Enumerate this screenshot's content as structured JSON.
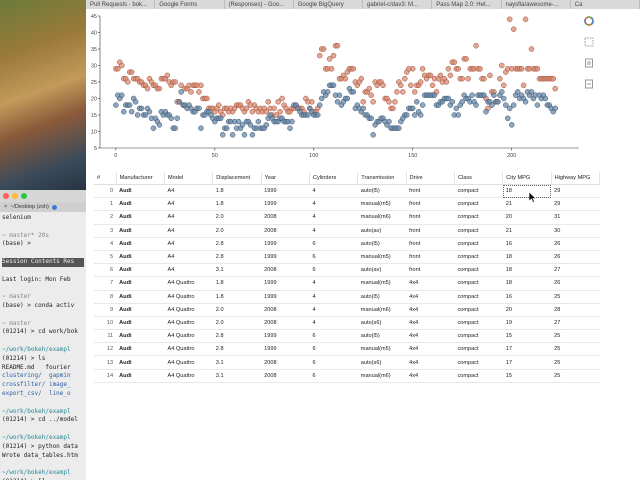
{
  "browser_tabs": [
    "Pull Requests · bok...",
    "Google Forms",
    "(Responses) - Goo...",
    "Google BigQuery",
    "gabriel-c/dav3: M...",
    "Pass Map 2.0: Het...",
    "naysfla/awesome-...",
    "Ca"
  ],
  "terminal": {
    "title": "~/Desktop (zsh)",
    "tab": "Session Contents Res",
    "lines": [
      {
        "t": "selenium",
        "c": ""
      },
      {
        "t": "",
        "c": ""
      },
      {
        "t": "~ master* 20s",
        "c": "tl-dim"
      },
      {
        "t": "(base) >",
        "c": ""
      },
      {
        "t": "",
        "c": ""
      },
      {
        "t": "Session Contents Res",
        "c": "tl-hl"
      },
      {
        "t": "",
        "c": ""
      },
      {
        "t": "Last login: Mon Feb",
        "c": ""
      },
      {
        "t": "",
        "c": ""
      },
      {
        "t": "~ master",
        "c": "tl-dim"
      },
      {
        "t": "(base) > conda activ",
        "c": ""
      },
      {
        "t": "",
        "c": ""
      },
      {
        "t": "~ master",
        "c": "tl-dim"
      },
      {
        "t": "(01214) > cd work/bok",
        "c": ""
      },
      {
        "t": "",
        "c": ""
      },
      {
        "t": "~/work/bokeh/exampl",
        "c": "tl-cyan"
      },
      {
        "t": "(01214) > ls",
        "c": ""
      },
      {
        "t": "README.md   fourier",
        "c": ""
      },
      {
        "t": "clustering/  gapmin",
        "c": "tl-blue"
      },
      {
        "t": "crossfilter/ image_",
        "c": "tl-blue"
      },
      {
        "t": "export_csv/  line_o",
        "c": "tl-blue"
      },
      {
        "t": "",
        "c": ""
      },
      {
        "t": "~/work/bokeh/exampl",
        "c": "tl-cyan"
      },
      {
        "t": "(01214) > cd ../model",
        "c": ""
      },
      {
        "t": "",
        "c": ""
      },
      {
        "t": "~/work/bokeh/exampl",
        "c": "tl-cyan"
      },
      {
        "t": "(01214) > python data",
        "c": ""
      },
      {
        "t": "Wrote data_tables.htm",
        "c": ""
      },
      {
        "t": "",
        "c": ""
      },
      {
        "t": "~/work/bokeh/exampl",
        "c": "tl-cyan"
      },
      {
        "t": "(01214) > []",
        "c": ""
      }
    ]
  },
  "chart_data": {
    "type": "scatter",
    "x_ticks": [
      "0",
      "50",
      "100",
      "150",
      "200"
    ],
    "y_ticks": [
      "5",
      "10",
      "15",
      "20",
      "25",
      "30",
      "35",
      "40",
      "45"
    ],
    "xlim": [
      -8,
      234
    ],
    "ylim": [
      5,
      45
    ],
    "series": [
      {
        "color": "#d98a72",
        "values": [
          29,
          29,
          31,
          30,
          26,
          26,
          25,
          28,
          28,
          26,
          26,
          26,
          25,
          25,
          24,
          24,
          23,
          26,
          25,
          24,
          24,
          23,
          23,
          26,
          26,
          26,
          27,
          25,
          24,
          25,
          25,
          19,
          19,
          24,
          18,
          23,
          23,
          24,
          22,
          24,
          24,
          24,
          22,
          24,
          20,
          20,
          20,
          17,
          17,
          17,
          16,
          17,
          18,
          16,
          15,
          17,
          17,
          16,
          17,
          16,
          17,
          18,
          18,
          18,
          17,
          16,
          17,
          19,
          18,
          16,
          18,
          17,
          16,
          17,
          16,
          17,
          16,
          19,
          17,
          15,
          17,
          15,
          19,
          16,
          20,
          18,
          17,
          16,
          16,
          17,
          17,
          18,
          17,
          17,
          17,
          16,
          20,
          19,
          17,
          19,
          16,
          16,
          17,
          33,
          35,
          35,
          29,
          29,
          32,
          29,
          33,
          36,
          36,
          26,
          26,
          27,
          26,
          28,
          29,
          29,
          29,
          25,
          24,
          25,
          26,
          19,
          22,
          22,
          23,
          21,
          19,
          25,
          24,
          25,
          25,
          24,
          20,
          20,
          19,
          17,
          17,
          19,
          22,
          25,
          24,
          22,
          26,
          28,
          29,
          24,
          29,
          22,
          24,
          24,
          25,
          29,
          27,
          26,
          27,
          27,
          24,
          26,
          22,
          26,
          27,
          25,
          26,
          25,
          29,
          27,
          31,
          31,
          29,
          29,
          26,
          26,
          32,
          32,
          26,
          29,
          29,
          29,
          36,
          29,
          29,
          26,
          26,
          20,
          17,
          27,
          22,
          22,
          19,
          19,
          26,
          30,
          24,
          28,
          29,
          44,
          29,
          41,
          29,
          29,
          29,
          29,
          24,
          44,
          29,
          29,
          35,
          29,
          29,
          29,
          26,
          26,
          26,
          26,
          26,
          26,
          26,
          26,
          23
        ]
      },
      {
        "color": "#6a8aa8",
        "values": [
          18,
          21,
          20,
          21,
          16,
          18,
          18,
          18,
          16,
          20,
          19,
          15,
          17,
          17,
          15,
          15,
          17,
          16,
          14,
          11,
          14,
          13,
          12,
          16,
          15,
          16,
          15,
          15,
          14,
          11,
          11,
          14,
          19,
          22,
          18,
          18,
          17,
          18,
          17,
          16,
          16,
          17,
          17,
          11,
          15,
          15,
          16,
          16,
          15,
          14,
          13,
          14,
          14,
          14,
          9,
          11,
          11,
          13,
          13,
          9,
          13,
          11,
          13,
          11,
          12,
          9,
          13,
          13,
          12,
          9,
          11,
          11,
          13,
          11,
          11,
          11,
          12,
          14,
          15,
          14,
          13,
          13,
          13,
          14,
          14,
          13,
          13,
          13,
          11,
          13,
          18,
          18,
          17,
          16,
          15,
          15,
          15,
          15,
          17,
          16,
          15,
          15,
          15,
          18,
          20,
          22,
          21,
          22,
          24,
          24,
          24,
          21,
          19,
          21,
          18,
          19,
          20,
          20,
          23,
          22,
          22,
          17,
          18,
          17,
          16,
          17,
          15,
          15,
          14,
          14,
          9,
          12,
          13,
          13,
          14,
          14,
          13,
          12,
          13,
          11,
          11,
          11,
          11,
          11,
          13,
          14,
          15,
          15,
          17,
          17,
          17,
          15,
          19,
          16,
          15,
          18,
          21,
          21,
          21,
          21,
          21,
          21,
          18,
          18,
          19,
          19,
          20,
          20,
          20,
          18,
          19,
          15,
          17,
          15,
          18,
          19,
          21,
          20,
          20,
          19,
          21,
          19,
          18,
          21,
          21,
          21,
          21,
          16,
          19,
          19,
          18,
          21,
          19,
          19,
          21,
          22,
          20,
          18,
          14,
          17,
          12,
          18,
          21,
          22,
          20,
          21,
          20,
          19,
          22,
          21,
          22,
          20,
          21,
          18,
          21,
          20,
          21,
          20,
          18,
          18,
          17,
          16,
          17
        ]
      }
    ]
  },
  "table": {
    "headers": [
      "#",
      "Manufacturer",
      "Model",
      "Displacement",
      "Year",
      "Cylinders",
      "Transmission",
      "Drive",
      "Class",
      "City MPG",
      "Highway MPG"
    ],
    "rows": [
      [
        "0",
        "Audi",
        "A4",
        "1.8",
        "1999",
        "4",
        "auto(l5)",
        "front",
        "compact",
        "18",
        "29"
      ],
      [
        "1",
        "Audi",
        "A4",
        "1.8",
        "1999",
        "4",
        "manual(m5)",
        "front",
        "compact",
        "21",
        "29"
      ],
      [
        "2",
        "Audi",
        "A4",
        "2.0",
        "2008",
        "4",
        "manual(m6)",
        "front",
        "compact",
        "20",
        "31"
      ],
      [
        "3",
        "Audi",
        "A4",
        "2.0",
        "2008",
        "4",
        "auto(av)",
        "front",
        "compact",
        "21",
        "30"
      ],
      [
        "4",
        "Audi",
        "A4",
        "2.8",
        "1999",
        "6",
        "auto(l5)",
        "front",
        "compact",
        "16",
        "26"
      ],
      [
        "5",
        "Audi",
        "A4",
        "2.8",
        "1999",
        "6",
        "manual(m5)",
        "front",
        "compact",
        "18",
        "26"
      ],
      [
        "6",
        "Audi",
        "A4",
        "3.1",
        "2008",
        "6",
        "auto(av)",
        "front",
        "compact",
        "18",
        "27"
      ],
      [
        "7",
        "Audi",
        "A4 Quattro",
        "1.8",
        "1999",
        "4",
        "manual(m5)",
        "4x4",
        "compact",
        "18",
        "26"
      ],
      [
        "8",
        "Audi",
        "A4 Quattro",
        "1.8",
        "1999",
        "4",
        "auto(l5)",
        "4x4",
        "compact",
        "16",
        "25"
      ],
      [
        "9",
        "Audi",
        "A4 Quattro",
        "2.0",
        "2008",
        "4",
        "manual(m6)",
        "4x4",
        "compact",
        "20",
        "28"
      ],
      [
        "10",
        "Audi",
        "A4 Quattro",
        "2.0",
        "2008",
        "4",
        "auto(s6)",
        "4x4",
        "compact",
        "19",
        "27"
      ],
      [
        "11",
        "Audi",
        "A4 Quattro",
        "2.8",
        "1999",
        "6",
        "auto(l5)",
        "4x4",
        "compact",
        "15",
        "25"
      ],
      [
        "12",
        "Audi",
        "A4 Quattro",
        "2.8",
        "1999",
        "6",
        "manual(m5)",
        "4x4",
        "compact",
        "17",
        "25"
      ],
      [
        "13",
        "Audi",
        "A4 Quattro",
        "3.1",
        "2008",
        "6",
        "auto(s6)",
        "4x4",
        "compact",
        "17",
        "25"
      ],
      [
        "14",
        "Audi",
        "A4 Quattro",
        "3.1",
        "2008",
        "6",
        "manual(m6)",
        "4x4",
        "compact",
        "15",
        "25"
      ]
    ]
  }
}
